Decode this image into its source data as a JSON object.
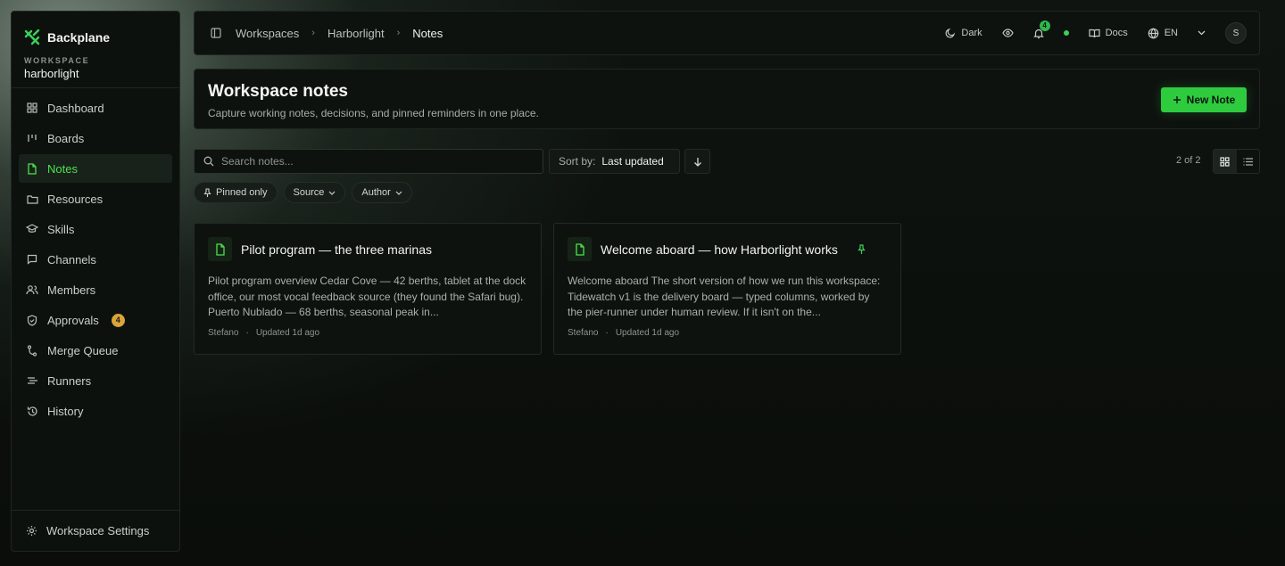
{
  "app": {
    "name": "Backplane"
  },
  "workspace": {
    "label": "WORKSPACE",
    "name": "harborlight"
  },
  "sidebar": {
    "items": [
      {
        "label": "Dashboard",
        "icon": "dashboard-icon"
      },
      {
        "label": "Boards",
        "icon": "boards-icon"
      },
      {
        "label": "Notes",
        "icon": "note-icon",
        "active": true
      },
      {
        "label": "Resources",
        "icon": "folder-icon"
      },
      {
        "label": "Skills",
        "icon": "graduation-cap-icon"
      },
      {
        "label": "Channels",
        "icon": "chat-icon"
      },
      {
        "label": "Members",
        "icon": "users-icon"
      },
      {
        "label": "Approvals",
        "icon": "shield-icon",
        "badge": "4"
      },
      {
        "label": "Merge Queue",
        "icon": "git-merge-icon"
      },
      {
        "label": "Runners",
        "icon": "runner-icon"
      },
      {
        "label": "History",
        "icon": "history-icon"
      }
    ],
    "footer": {
      "label": "Workspace Settings",
      "icon": "gear-icon"
    }
  },
  "topbar": {
    "breadcrumb": [
      "Workspaces",
      "Harborlight",
      "Notes"
    ],
    "theme_label": "Dark",
    "notifications_count": "4",
    "docs_label": "Docs",
    "language": "EN",
    "avatar_initial": "S"
  },
  "header": {
    "title": "Workspace notes",
    "subtitle": "Capture working notes, decisions, and pinned reminders in one place.",
    "new_note_label": "New Note"
  },
  "toolbar": {
    "search_placeholder": "Search notes...",
    "sort_label": "Sort by:",
    "sort_value": "Last updated",
    "count": "2 of 2"
  },
  "filters": [
    {
      "label": "Pinned only"
    },
    {
      "label": "Source"
    },
    {
      "label": "Author"
    }
  ],
  "notes": [
    {
      "title": "Pilot program — the three marinas",
      "excerpt": "Pilot program overview Cedar Cove — 42 berths, tablet at the dock office, our most vocal feedback source (they found the Safari bug). Puerto Nublado — 68 berths, seasonal peak in...",
      "author": "Stefano",
      "updated": "Updated 1d ago",
      "pinned": false
    },
    {
      "title": "Welcome aboard — how Harborlight works",
      "excerpt": "Welcome aboard The short version of how we run this workspace: Tidewatch v1 is the delivery board — typed columns, worked by the pier-runner under human review. If it isn't on the...",
      "author": "Stefano",
      "updated": "Updated 1d ago",
      "pinned": true
    }
  ],
  "colors": {
    "accent": "#2ecb3f",
    "active_nav": "#4ee04e",
    "badge": "#d9a43a"
  }
}
